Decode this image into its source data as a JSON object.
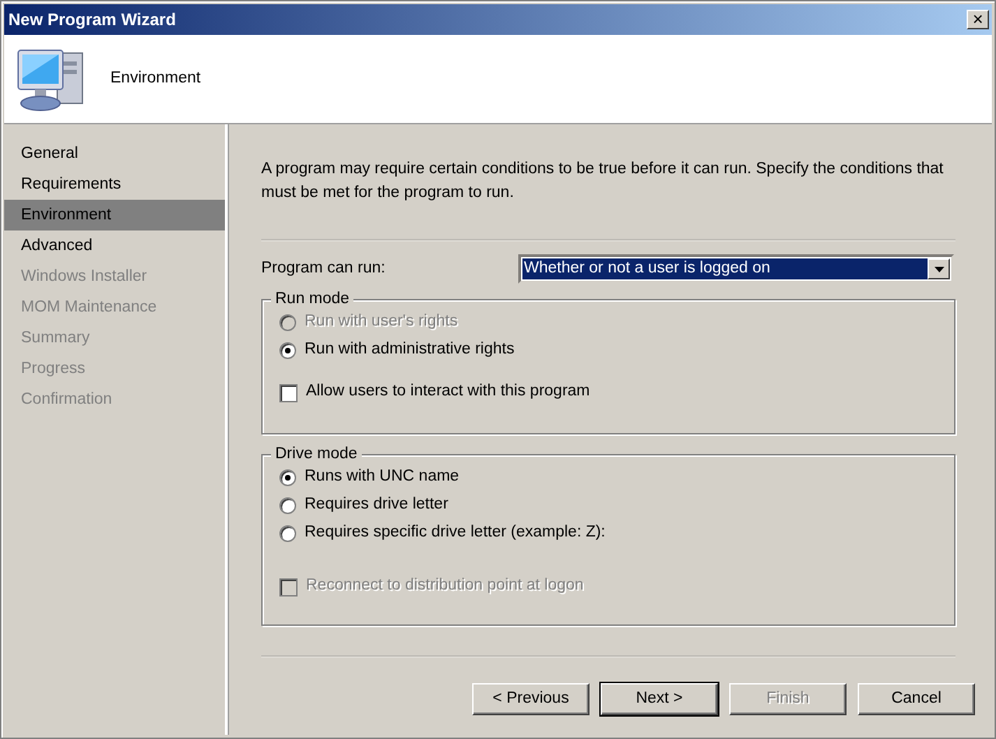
{
  "window": {
    "title": "New Program Wizard",
    "close": "×"
  },
  "header": {
    "title": "Environment"
  },
  "sidebar": {
    "items": [
      {
        "label": "General",
        "selected": false,
        "disabled": false
      },
      {
        "label": "Requirements",
        "selected": false,
        "disabled": false
      },
      {
        "label": "Environment",
        "selected": true,
        "disabled": false
      },
      {
        "label": "Advanced",
        "selected": false,
        "disabled": false
      },
      {
        "label": "Windows Installer",
        "selected": false,
        "disabled": true
      },
      {
        "label": "MOM Maintenance",
        "selected": false,
        "disabled": true
      },
      {
        "label": "Summary",
        "selected": false,
        "disabled": true
      },
      {
        "label": "Progress",
        "selected": false,
        "disabled": true
      },
      {
        "label": "Confirmation",
        "selected": false,
        "disabled": true
      }
    ]
  },
  "intro": "A program may require certain conditions to be true before it can run. Specify the conditions that must be met for the program to run.",
  "program_can_run": {
    "label": "Program can run:",
    "value": "Whether or not a user is logged on"
  },
  "groups": [
    {
      "title": "Run mode",
      "options": [
        {
          "kind": "radio",
          "label": "Run with user's rights",
          "checked": false,
          "disabled": true
        },
        {
          "kind": "radio",
          "label": "Run with administrative rights",
          "checked": true,
          "disabled": false
        },
        {
          "kind": "checkbox",
          "label": "Allow users to interact with this program",
          "checked": false,
          "disabled": false
        }
      ]
    },
    {
      "title": "Drive mode",
      "options": [
        {
          "kind": "radio",
          "label": "Runs with UNC name",
          "checked": true,
          "disabled": false
        },
        {
          "kind": "radio",
          "label": "Requires drive letter",
          "checked": false,
          "disabled": false
        },
        {
          "kind": "radio",
          "label": "Requires specific drive letter (example: Z):",
          "checked": false,
          "disabled": false
        },
        {
          "kind": "checkbox",
          "label": "Reconnect to distribution point at logon",
          "checked": false,
          "disabled": true
        }
      ]
    }
  ],
  "buttons": [
    {
      "label": "< Previous",
      "disabled": false,
      "default": false
    },
    {
      "label": "Next >",
      "disabled": false,
      "default": true
    },
    {
      "label": "Finish",
      "disabled": true,
      "default": false
    },
    {
      "label": "Cancel",
      "disabled": false,
      "default": false
    }
  ]
}
